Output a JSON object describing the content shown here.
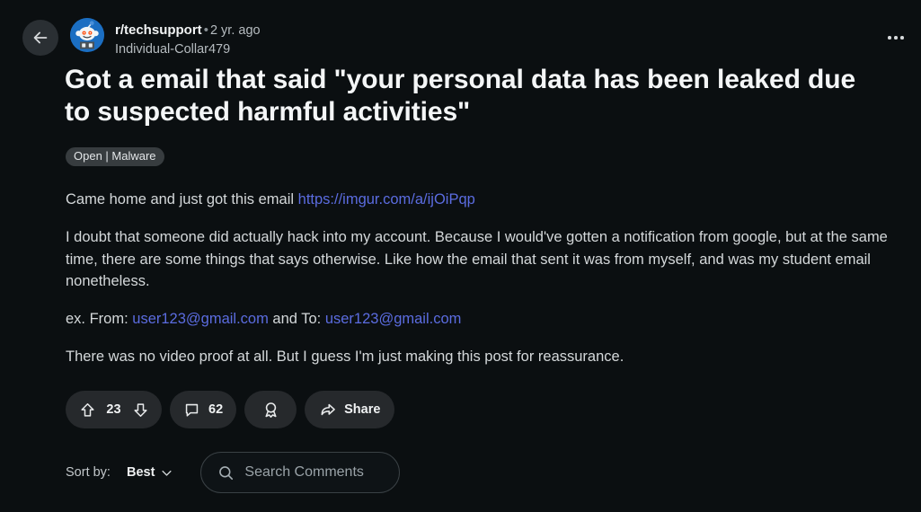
{
  "post": {
    "subreddit": "r/techsupport",
    "separator": "•",
    "age": "2 yr. ago",
    "author": "Individual-Collar479",
    "title": "Got a email that said \"your personal data has been leaked due to suspected harmful activities\"",
    "flair": "Open | Malware",
    "body": {
      "para1_pre": "Came home and just got this email ",
      "para1_link": "https://imgur.com/a/ijOiPqp",
      "para2": "I doubt that someone did actually hack into my account. Because I would've gotten a notification from google, but at the same time, there are some things that says otherwise. Like how the email that sent it was from myself, and was my student email nonetheless.",
      "para3_pre": "ex. From: ",
      "para3_link1": "user123@gmail.com",
      "para3_mid": " and To: ",
      "para3_link2": "user123@gmail.com",
      "para4": "There was no video proof at all. But I guess I'm just making this post for reassurance."
    }
  },
  "actions": {
    "vote_count": "23",
    "comment_count": "62",
    "share_label": "Share",
    "upvote_icon": "arrow-up-icon",
    "downvote_icon": "arrow-down-icon",
    "comment_icon": "comment-bubble-icon",
    "award_icon": "award-medal-icon",
    "share_icon": "share-arrow-icon"
  },
  "comments_bar": {
    "sort_label": "Sort by:",
    "sort_value": "Best",
    "chevron_icon": "chevron-down-icon",
    "search_icon": "search-icon",
    "search_placeholder": "Search Comments"
  },
  "nav": {
    "back_icon": "arrow-left-icon",
    "overflow_icon": "more-horizontal-icon",
    "avatar_icon": "reddit-snoo-avatar"
  },
  "colors": {
    "background": "#0b0f11",
    "link": "#5b6ce0",
    "avatar_blue": "#1b6ec2",
    "pill": "#26292c",
    "flair": "#373c3f",
    "text": "#d4d8da"
  }
}
